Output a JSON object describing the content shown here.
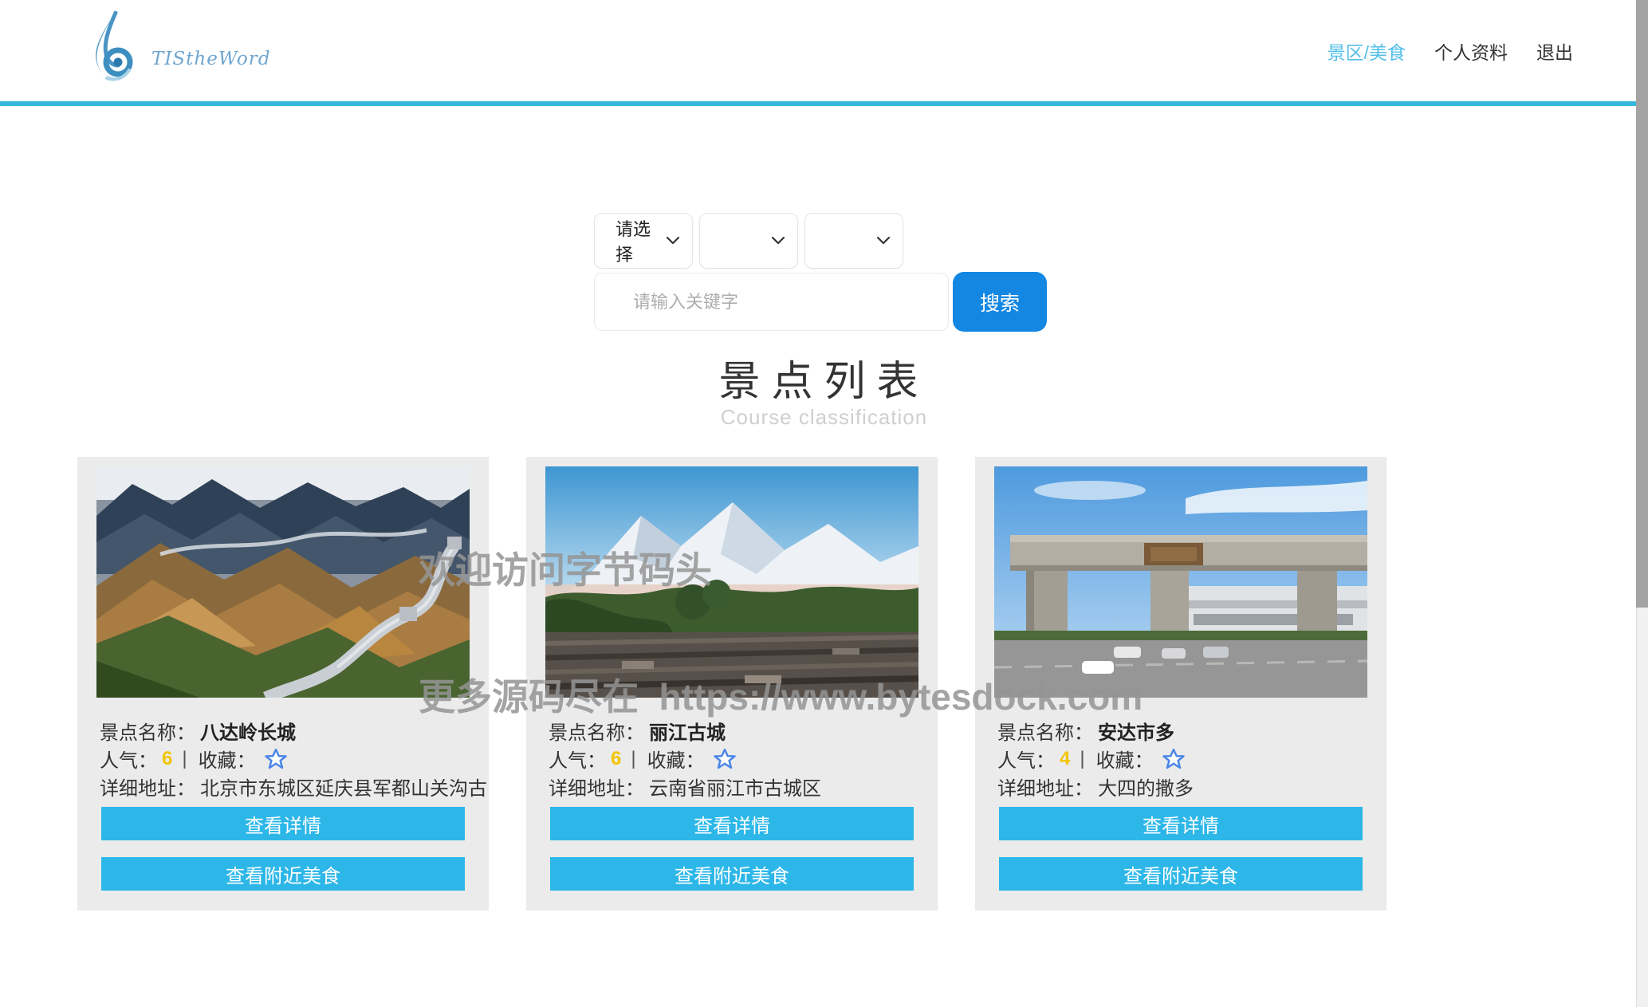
{
  "header": {
    "brand_text": "TIStheWord",
    "nav": {
      "items": [
        {
          "label": "景区/美食",
          "active": true
        },
        {
          "label": "个人资料",
          "active": false
        },
        {
          "label": "退出",
          "active": false
        }
      ]
    }
  },
  "search": {
    "selects": [
      "请选择",
      "",
      ""
    ],
    "keyword_placeholder": "请输入关键字",
    "search_button": "搜索"
  },
  "section": {
    "title": "景点列表",
    "subtitle": "Course classification"
  },
  "labels": {
    "name": "景点名称：",
    "popularity": "人气：",
    "separator": "|",
    "favorite": "收藏：",
    "address": "详细地址：",
    "detail_button": "查看详情",
    "food_button": "查看附近美食"
  },
  "cards": [
    {
      "name": "八达岭长城",
      "popularity": "6",
      "address": "北京市东城区延庆县军都山关沟古"
    },
    {
      "name": "丽江古城",
      "popularity": "6",
      "address": "云南省丽江市古城区"
    },
    {
      "name": "安达市多",
      "popularity": "4",
      "address": "大四的撒多"
    }
  ],
  "watermark": {
    "line1": "欢迎访问字节码头",
    "line2": "更多源码尽在  https://www.bytesdock.com"
  },
  "icons": {
    "logo": "blue-swirl-flame",
    "select_chevron": "chevron-down",
    "favorite_star": "star-outline"
  },
  "colors": {
    "header_line": "#38b7dd",
    "nav_active": "#53bfe8",
    "search_button": "#1487e3",
    "card_button": "#2db7e8",
    "card_background": "#ebebeb",
    "popularity_value": "#f2c500",
    "star": "#4a86e8",
    "watermark": "#949494"
  }
}
